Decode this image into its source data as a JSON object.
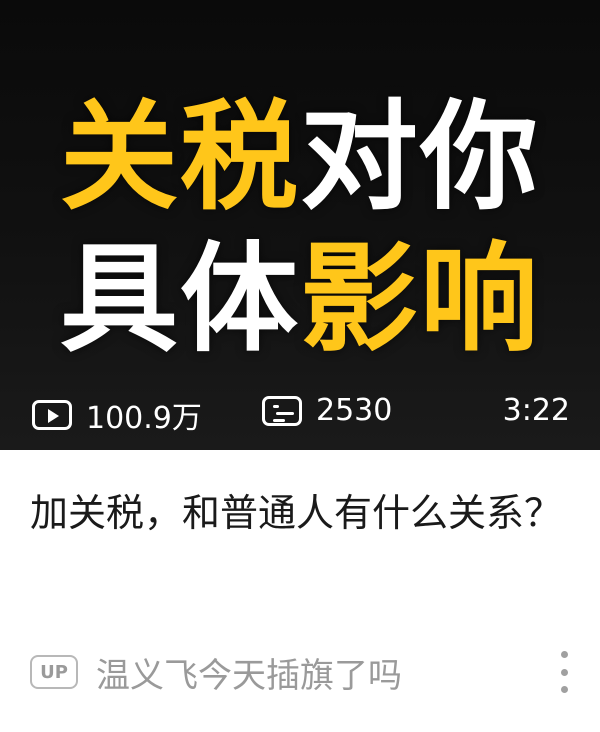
{
  "thumbnail": {
    "line1": [
      {
        "text": "关税",
        "color": "yellow"
      },
      {
        "text": "对你",
        "color": "white"
      }
    ],
    "line2": [
      {
        "text": "具体",
        "color": "white"
      },
      {
        "text": "影响",
        "color": "yellow"
      }
    ],
    "colors": {
      "yellow": "#ffc61a",
      "white": "#ffffff",
      "background": "#0a0a0a"
    }
  },
  "stats": {
    "play_icon": "play-icon",
    "plays": "100.9万",
    "danmaku_icon": "danmaku-icon",
    "danmaku": "2530",
    "duration": "3:22"
  },
  "video": {
    "title": "加关税，和普通人有什么关系？"
  },
  "meta": {
    "badge": "UP",
    "author": "温义飞今天插旗了吗",
    "more_icon": "more-vertical-icon"
  }
}
